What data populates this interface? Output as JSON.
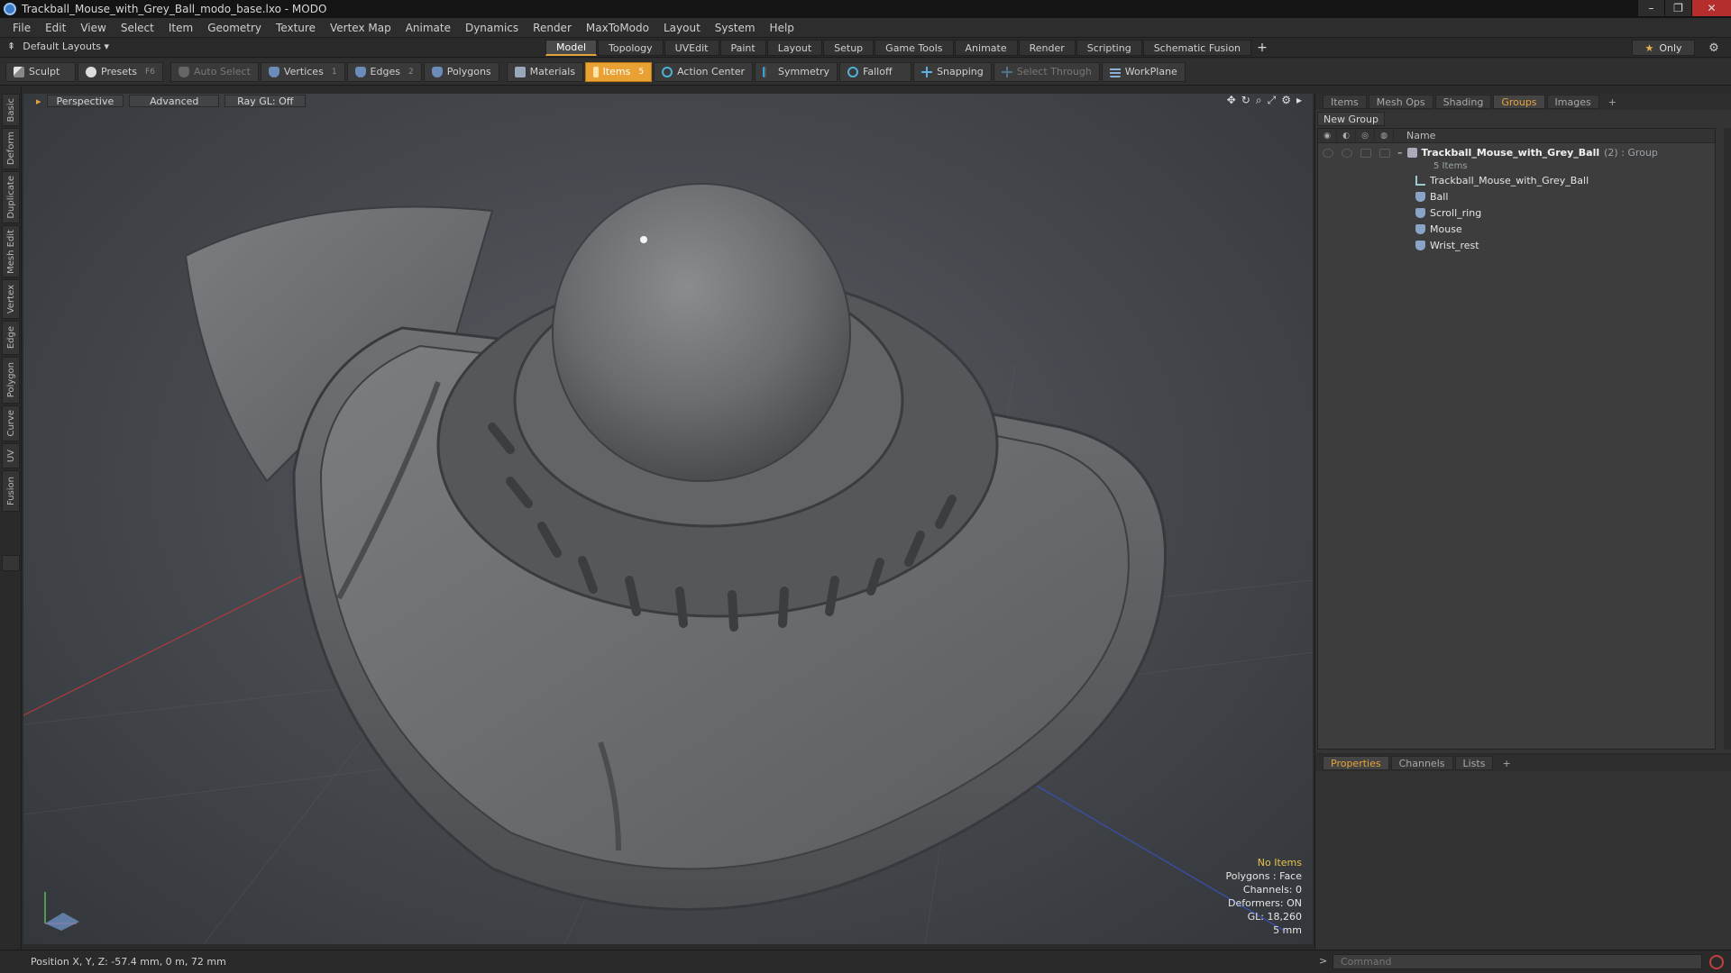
{
  "window": {
    "title": "Trackball_Mouse_with_Grey_Ball_modo_base.lxo - MODO",
    "controls": [
      "–",
      "❐",
      "✕"
    ]
  },
  "menu": [
    "File",
    "Edit",
    "View",
    "Select",
    "Item",
    "Geometry",
    "Texture",
    "Vertex Map",
    "Animate",
    "Dynamics",
    "Render",
    "MaxToModo",
    "Layout",
    "System",
    "Help"
  ],
  "layout_bar": {
    "dropdown": "Default Layouts ▾",
    "tabs": [
      "Model",
      "Topology",
      "UVEdit",
      "Paint",
      "Layout",
      "Setup",
      "Game Tools",
      "Animate",
      "Render",
      "Scripting",
      "Schematic Fusion"
    ],
    "active_tab": "Model",
    "add_tab": "+",
    "only_label": "Only",
    "star": "★"
  },
  "toolbar": {
    "sculpt": "Sculpt",
    "presets": "Presets",
    "presets_key": "F6",
    "auto_select": "Auto Select",
    "vertices": "Vertices",
    "vertices_num": "1",
    "edges": "Edges",
    "edges_num": "2",
    "polygons": "Polygons",
    "materials": "Materials",
    "items": "Items",
    "items_num": "5",
    "action_center": "Action Center",
    "symmetry": "Symmetry",
    "falloff": "Falloff",
    "snapping": "Snapping",
    "select_through": "Select Through",
    "workplane": "WorkPlane"
  },
  "left_tabs": [
    "Basic",
    "Deform",
    "Duplicate",
    "Mesh Edit",
    "Vertex",
    "Edge",
    "Polygon",
    "Curve",
    "UV",
    "Fusion"
  ],
  "viewport": {
    "perspective": "Perspective",
    "advanced": "Advanced",
    "raygl": "Ray GL: Off",
    "info": {
      "no_items": "No Items",
      "polygons": "Polygons : Face",
      "channels": "Channels: 0",
      "deformers": "Deformers: ON",
      "gl": "GL: 18,260",
      "scale": "5 mm"
    }
  },
  "right_panel": {
    "tabs": [
      "Items",
      "Mesh Ops",
      "Shading",
      "Groups",
      "Images"
    ],
    "active_tab": "Groups",
    "add_tab": "+",
    "new_group": "New Group",
    "column_name": "Name",
    "group": {
      "name": "Trackball_Mouse_with_Grey_Ball",
      "suffix": "(2) : Group",
      "count": "5 Items"
    },
    "items": [
      "Trackball_Mouse_with_Grey_Ball",
      "Ball",
      "Scroll_ring",
      "Mouse",
      "Wrist_rest"
    ]
  },
  "properties_panel": {
    "tabs": [
      "Properties",
      "Channels",
      "Lists"
    ],
    "active_tab": "Properties",
    "add_tab": "+"
  },
  "status": {
    "position": "Position X, Y, Z:  -57.4 mm, 0 m, 72 mm",
    "command_placeholder": "Command",
    "arrow": ">"
  },
  "colors": {
    "accent": "#e9a133",
    "viewport_bg": "#474b50",
    "model_grey": "#6b6d70"
  }
}
